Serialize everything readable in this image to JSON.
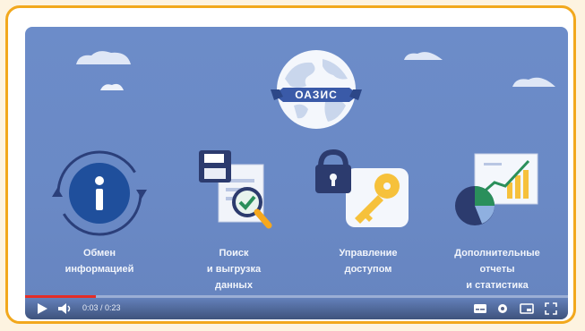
{
  "logo": {
    "text": "ОАЗИС"
  },
  "features": [
    {
      "id": "exchange",
      "lines": [
        "Обмен",
        "информацией"
      ],
      "icon": "info-cycle-icon"
    },
    {
      "id": "search",
      "lines": [
        "Поиск",
        "и выгрузка",
        "данных"
      ],
      "icon": "document-search-icon"
    },
    {
      "id": "access",
      "lines": [
        "Управление",
        "доступом"
      ],
      "icon": "lock-key-icon"
    },
    {
      "id": "reports",
      "lines": [
        "Дополнительные",
        "отчеты",
        "и статистика"
      ],
      "icon": "chart-report-icon"
    }
  ],
  "player": {
    "time": "0:03 / 0:23",
    "progress": 0.13,
    "controls": [
      "play-icon",
      "volume-icon",
      "subtitles-icon",
      "settings-icon",
      "miniplayer-icon",
      "fullscreen-icon"
    ]
  },
  "colors": {
    "frame": "#f2a81d",
    "video_bg": "#6c8cc9",
    "progress": "#e52d27",
    "accent_key": "#f6c13b"
  }
}
